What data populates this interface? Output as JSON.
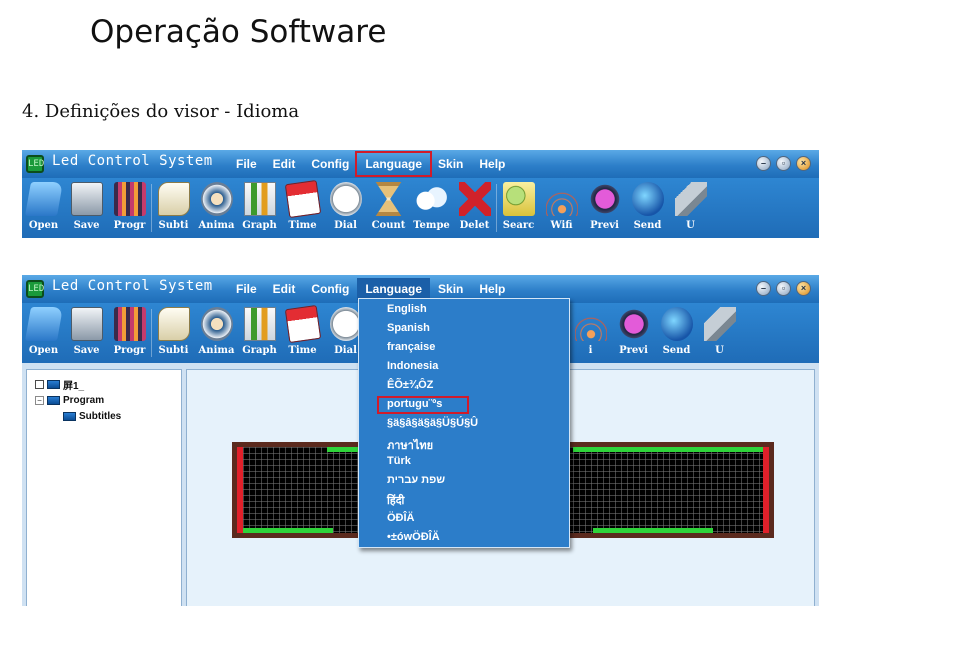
{
  "slide": {
    "title": "Operação Software",
    "section_heading": "4. Definições do visor - Idioma"
  },
  "app": {
    "title": "Led Control System",
    "logo_text": "LED"
  },
  "menu": {
    "file": "File",
    "edit": "Edit",
    "config": "Config",
    "language": "Language",
    "skin": "Skin",
    "help": "Help"
  },
  "toolbar_top": [
    {
      "label": "Open",
      "icon": "folder-icon"
    },
    {
      "label": "Save",
      "icon": "disk-icon"
    },
    {
      "label": "Progr",
      "icon": "film-icon"
    },
    {
      "label": "Subti",
      "icon": "scroll-icon"
    },
    {
      "label": "Anima",
      "icon": "film-reel-icon"
    },
    {
      "label": "Graph",
      "icon": "chart-icon"
    },
    {
      "label": "Time",
      "icon": "calendar-icon"
    },
    {
      "label": "Dial",
      "icon": "clock-icon"
    },
    {
      "label": "Count",
      "icon": "hourglass-icon"
    },
    {
      "label": "Tempe",
      "icon": "cloud-icon"
    },
    {
      "label": "Delet",
      "icon": "delete-x-icon"
    },
    {
      "label": "Searc",
      "icon": "search-icon"
    },
    {
      "label": "Wifi",
      "icon": "wifi-icon"
    },
    {
      "label": "Previ",
      "icon": "play-icon"
    },
    {
      "label": "Send",
      "icon": "globe-icon"
    },
    {
      "label": "U",
      "icon": "usb-icon"
    }
  ],
  "toolbar_bottom_visible": [
    {
      "label": "Open",
      "icon": "folder-icon"
    },
    {
      "label": "Save",
      "icon": "disk-icon"
    },
    {
      "label": "Progr",
      "icon": "film-icon"
    },
    {
      "label": "Subti",
      "icon": "scroll-icon"
    },
    {
      "label": "Anima",
      "icon": "film-reel-icon"
    },
    {
      "label": "Graph",
      "icon": "chart-icon"
    },
    {
      "label": "Time",
      "icon": "calendar-icon"
    },
    {
      "label": "Dial",
      "icon": "clock-icon"
    }
  ],
  "toolbar_bottom_right": [
    {
      "label": "i",
      "icon": "wifi-icon"
    },
    {
      "label": "Previ",
      "icon": "play-icon"
    },
    {
      "label": "Send",
      "icon": "globe-icon"
    },
    {
      "label": "U",
      "icon": "usb-icon"
    }
  ],
  "tree": {
    "screen": "屏1_",
    "program": "Program",
    "subtitles": "Subtitles",
    "expander": "−"
  },
  "language_menu": {
    "items": [
      "English",
      "Spanish",
      "française",
      "Indonesia",
      "ÊÕ±¾ÔZ",
      "portugu¨ºs",
      "§ä§â§ä§ä§Ü§Ú§Û",
      "ภาษาไทย",
      "Türk",
      "שפת עברית",
      "हिंदी",
      "ÖÐÎÄ",
      "•±ówÖÐÎÄ"
    ],
    "highlighted_index": 5
  },
  "colors": {
    "highlight_border": "#d11b2a",
    "menu_blue": "#2c7dc9",
    "led_red": "#e0202a",
    "led_green": "#2fd33a"
  }
}
